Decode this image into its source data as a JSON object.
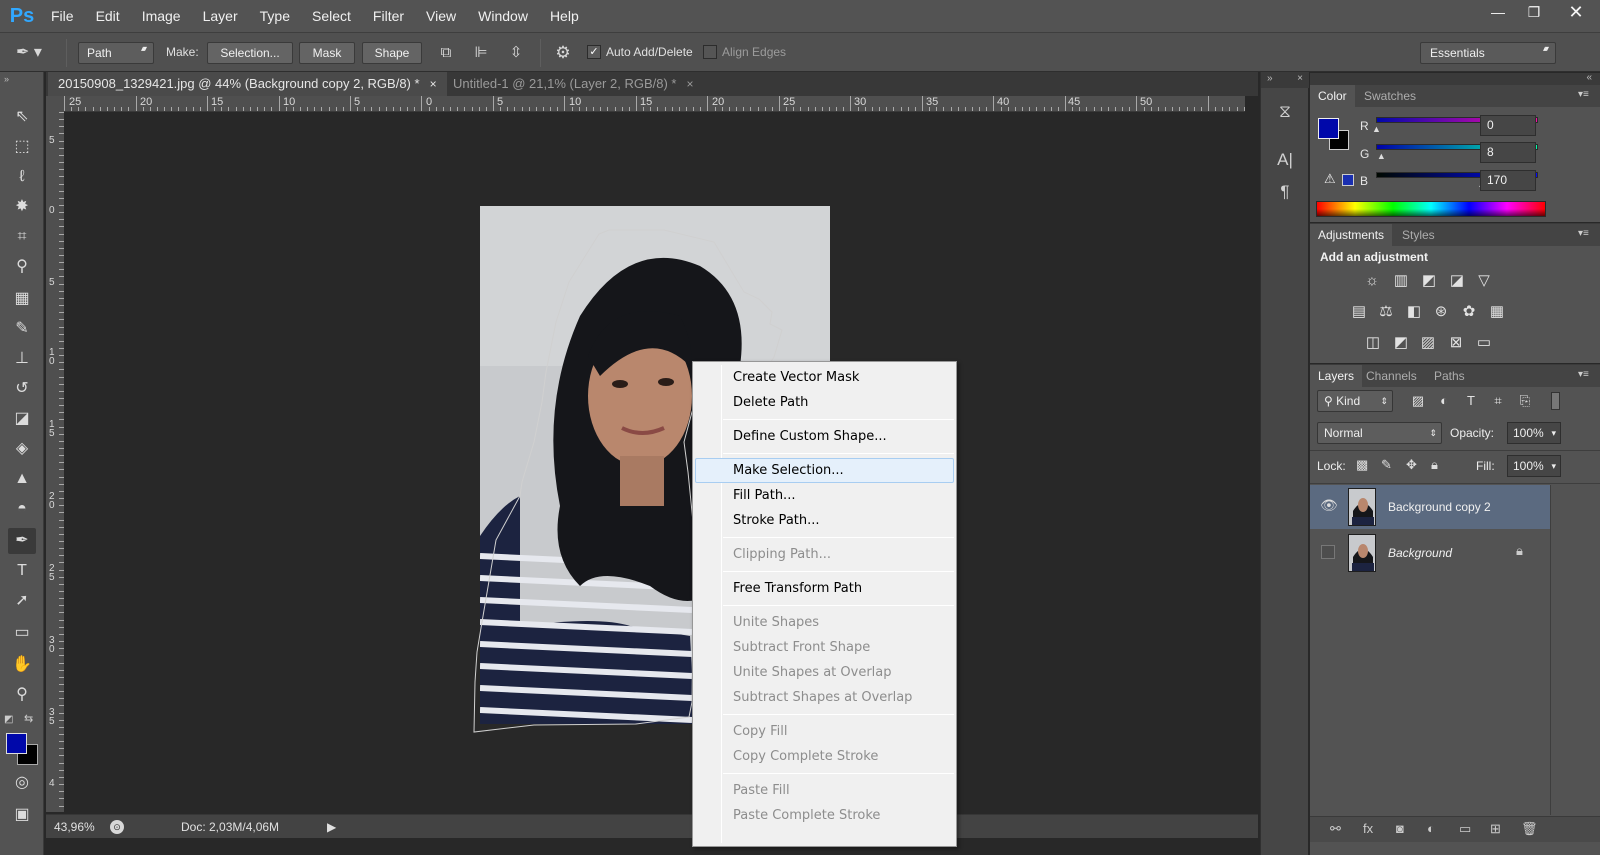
{
  "app": {
    "logo": "Ps"
  },
  "menu": [
    "File",
    "Edit",
    "Image",
    "Layer",
    "Type",
    "Select",
    "Filter",
    "View",
    "Window",
    "Help"
  ],
  "window_controls": {
    "minimize": "—",
    "restore": "❐",
    "close": "✕"
  },
  "options": {
    "tool_mode": "Path",
    "make_label": "Make:",
    "selection_btn": "Selection...",
    "mask_btn": "Mask",
    "shape_btn": "Shape",
    "auto_add_delete": "Auto Add/Delete",
    "auto_add_checked": true,
    "align_edges": "Align Edges",
    "workspace": "Essentials"
  },
  "tabs": [
    {
      "title": "20150908_1329421.jpg @ 44% (Background copy 2, RGB/8) *",
      "close": "×",
      "active": true
    },
    {
      "title": "Untitled-1 @ 21,1% (Layer 2, RGB/8) *",
      "close": "×",
      "active": false
    }
  ],
  "ruler": {
    "h": [
      "25",
      "20",
      "15",
      "10",
      "5",
      "0",
      "5",
      "10",
      "15",
      "20",
      "25",
      "30",
      "35",
      "40",
      "45",
      "50"
    ],
    "v": [
      "5",
      "0",
      "5",
      "1 0",
      "1 5",
      "2 0",
      "2 5",
      "3 0",
      "3 5",
      "4"
    ]
  },
  "status": {
    "zoom": "43,96%",
    "doc": "Doc: 2,03M/4,06M"
  },
  "color_panel": {
    "tabs": [
      "Color",
      "Swatches"
    ],
    "r_label": "R",
    "g_label": "G",
    "b_label": "B",
    "r": "0",
    "g": "8",
    "b": "170",
    "r_fraction": 0,
    "g_fraction": 0.031,
    "b_fraction": 0.667,
    "fg": "#0008aa",
    "bg": "#000000"
  },
  "adjustments_panel": {
    "tabs": [
      "Adjustments",
      "Styles"
    ],
    "heading": "Add an adjustment"
  },
  "layers_panel": {
    "tabs": [
      "Layers",
      "Channels",
      "Paths"
    ],
    "kind": "Kind",
    "blend_mode": "Normal",
    "opacity_label": "Opacity:",
    "opacity": "100%",
    "lock_label": "Lock:",
    "fill_label": "Fill:",
    "fill": "100%",
    "layers": [
      {
        "name": "Background copy 2",
        "visible": true,
        "selected": true
      },
      {
        "name": "Background",
        "visible": false,
        "selected": false,
        "locked": true
      }
    ]
  },
  "context_menu": [
    {
      "label": "Create Vector Mask",
      "disabled": false
    },
    {
      "label": "Delete Path",
      "disabled": false
    },
    {
      "sep": true
    },
    {
      "label": "Define Custom Shape...",
      "disabled": false
    },
    {
      "sep": true
    },
    {
      "label": "Make Selection...",
      "disabled": false,
      "hover": true
    },
    {
      "label": "Fill Path...",
      "disabled": false
    },
    {
      "label": "Stroke Path...",
      "disabled": false
    },
    {
      "sep": true
    },
    {
      "label": "Clipping Path...",
      "disabled": true
    },
    {
      "sep": true
    },
    {
      "label": "Free Transform Path",
      "disabled": false
    },
    {
      "sep": true
    },
    {
      "label": "Unite Shapes",
      "disabled": true
    },
    {
      "label": "Subtract Front Shape",
      "disabled": true
    },
    {
      "label": "Unite Shapes at Overlap",
      "disabled": true
    },
    {
      "label": "Subtract Shapes at Overlap",
      "disabled": true
    },
    {
      "sep": true
    },
    {
      "label": "Copy Fill",
      "disabled": true
    },
    {
      "label": "Copy Complete Stroke",
      "disabled": true
    },
    {
      "sep": true
    },
    {
      "label": "Paste Fill",
      "disabled": true
    },
    {
      "label": "Paste Complete Stroke",
      "disabled": true
    }
  ]
}
